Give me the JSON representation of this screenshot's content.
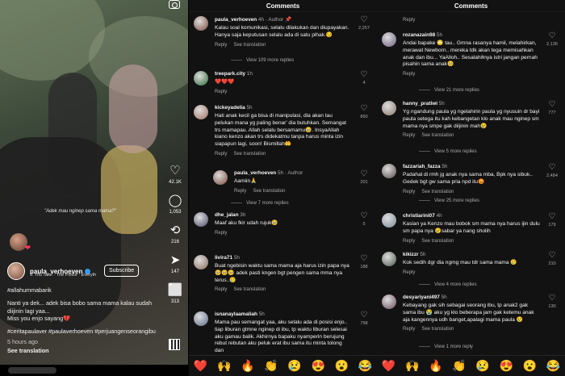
{
  "video": {
    "overlay_text": "\"Adek mau nginep sama mama?\"",
    "username": "paula_verhoeven",
    "music": "♫ You Take · The Police · Everyth",
    "subscribe_label": "Subscribe",
    "hashtag_line": "#allahummabarik",
    "caption": "Nanti ya dek... adek bisa bobo sama mama kalau sudah diijinin lagi yaa...",
    "caption2": "Miss you enjo sayang💔",
    "hashtags": "#ceritapaulaver #paulaverhoeven #perjuangenseorangibu",
    "time": "5 hours ago",
    "see_translation": "See translation",
    "actions": [
      {
        "icon": "heart-icon",
        "glyph": "♡",
        "count": "42.1K"
      },
      {
        "icon": "comment-icon",
        "glyph": "◯",
        "count": "1,053"
      },
      {
        "icon": "repost-icon",
        "glyph": "⟲",
        "count": "216"
      },
      {
        "icon": "share-icon",
        "glyph": "➤",
        "count": "147"
      },
      {
        "icon": "bookmark-icon",
        "glyph": "⬜",
        "count": "313"
      }
    ]
  },
  "comments_title": "Comments",
  "panel1": [
    {
      "user": "paula_verhoeven",
      "time": "4h · Author 📌",
      "text": "Kalau soal komunikasi, selalu dilakukan dan diupayakan.\nHanya saja keputusan selalu ada di satu pihak.😏",
      "reply": "Reply",
      "see": "See translation",
      "likes": "2,257",
      "color": "#7a4a3a"
    },
    {
      "more": "View 109 more replies"
    },
    {
      "user": "treepark.city",
      "time": "1h",
      "text": "❤️❤️❤️",
      "reply": "Reply",
      "see": "",
      "likes": "4",
      "color": "#2e6b3a"
    },
    {
      "user": "kickeyadelia",
      "time": "5h ",
      "text": "Hati anak kecil ga bisa di manipulasi, dia akan tau pelukan mana yg paling benar' dia butuhkan. Semangat trs mamapau. Allah selalu bersamamu🥹. InsyaAllah kiano kenzo akan trs didekatmu tanpa harus minta izin siapapun lagi, soon! Bismillah🤲",
      "reply": "Reply",
      "see": "See translation",
      "likes": "860",
      "color": "#a07060"
    },
    {
      "user": "paula_verhoeven",
      "time": "5h · Author",
      "text": "Aamiin🙏",
      "reply": "Reply",
      "see": "See translation",
      "likes": "201",
      "color": "#7a4a3a",
      "indent": true
    },
    {
      "more": "View 7 more replies"
    },
    {
      "user": "dhe_jalan",
      "time": "3h",
      "text": "Maaf aku fkir udah rujuk🥹",
      "reply": "Reply",
      "see": "",
      "likes": "5",
      "color": "#4a4a6a"
    },
    {
      "user": "livira71",
      "time": "5h ",
      "text": "Buat ngebisin waktu sama mama aja harus izin papa nya 🥺🥺🥺 adek pasti kngen bgt pengen sama mma nya terus..🥲",
      "reply": "Reply",
      "see": "See translation",
      "likes": "188",
      "color": "#8a6a5a"
    },
    {
      "user": "isnanaylaamaliah",
      "time": "5h",
      "text": "Mama pau semangat yaa, aku selalu ada di posisi enjo.. tiap liburan gtmne nginep di ibu, tp waktu liburan selesai aku gamau balik. Akhirnya bapaku nyamperin berujung rebut rebutan aku peluk erat ibu sama itu minta tolong dan",
      "reply": "",
      "see": "",
      "likes": "758",
      "color": "#5a6a8a"
    }
  ],
  "panel2": [
    {
      "user": "",
      "time": "",
      "text": "",
      "reply": "Reply",
      "see": "",
      "likes": "",
      "color": ""
    },
    {
      "user": "rozanazain98",
      "time": "5h ",
      "text": "Andai bapake 🙄 tau.. Gmna rasanya hamil, melahirkan, merawat Newborn.. mereka tdk akan tega memisahkan anak dan ibu... YaAlloh.. Sesalahðnya istri jangan pernah pisahin sama anak🥺",
      "reply": "Reply",
      "see": "",
      "likes": "2,136",
      "color": "#6a5a7a"
    },
    {
      "more": "View 21 more replies"
    },
    {
      "user": "hanny_pratiwi",
      "time": "5h ",
      "text": "Yg ngandung paula yg ngelahirin paula yg nyusuin dr bayi paula setega itu kah kebangetan klo anak mau nginep sm mama nya smpe gak diijinin mah😢",
      "reply": "Reply",
      "see": "See translation",
      "likes": "777",
      "color": "#8a7a6a"
    },
    {
      "more": "View 5 more replies"
    },
    {
      "user": "fazzariah_fazza",
      "time": "5h ",
      "text": "Padahal di rmh jg anak nya sama mba, Bpk nya sibuk.. Gedek bgt gw sama pria npd itu😡",
      "reply": "Reply",
      "see": "See translation",
      "likes": "2,484",
      "color": "#5a4a4a"
    },
    {
      "more": "View 25 more replies"
    },
    {
      "user": "christiarini07",
      "time": "4h ",
      "text": "Kasian ya Kenzo mau bobok sm mama nya harus ijin dulu sm papa nya 😢sabar ya nang sholih",
      "reply": "Reply",
      "see": "See translation",
      "likes": "179",
      "color": "#7a8a9a"
    },
    {
      "user": "kikizzr",
      "time": "5h ",
      "text": "Kok sedih dgr dia ngmg mau tdr sama mama 🥲",
      "reply": "Reply",
      "see": "",
      "likes": "210",
      "color": "#4a5a4a"
    },
    {
      "more": "View 4 more replies"
    },
    {
      "user": "desyariyani497",
      "time": "5h ",
      "text": "Kebayang gak sih sebagai seorang ibu, tp anak2 gak sama ibu 😭 aku yg klo beberapa jam gak ketemu anak aja kangennya udh banget,apalagi mama paula 😢",
      "reply": "Reply",
      "see": "See translation",
      "likes": "130",
      "color": "#6a4a5a"
    },
    {
      "more": "View 1 more reply"
    }
  ],
  "emoji_bar": [
    "❤️",
    "🙌",
    "🔥",
    "👏",
    "😢",
    "😍",
    "😮",
    "😂"
  ]
}
